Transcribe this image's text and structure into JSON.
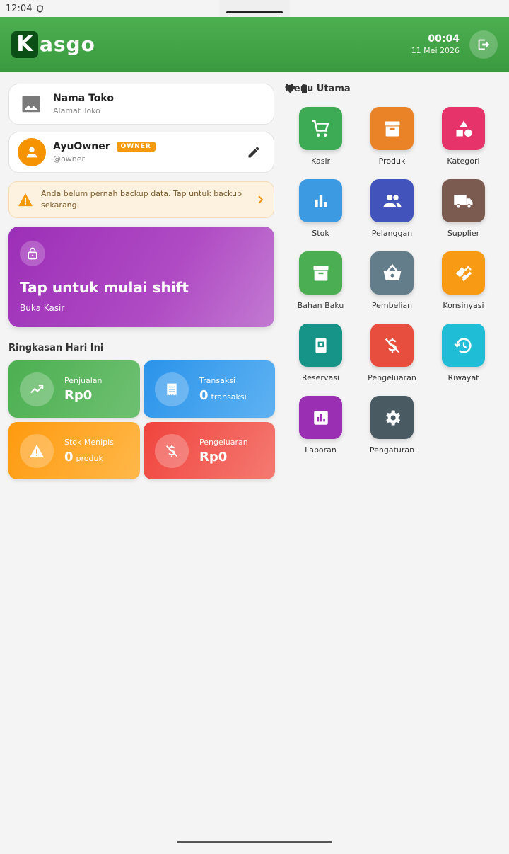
{
  "status": {
    "time": "12:04"
  },
  "header": {
    "logo_k": "K",
    "logo_rest": "asgo",
    "clock": "00:04",
    "date": "11 Mei 2026"
  },
  "store": {
    "name": "Nama Toko",
    "address": "Alamat Toko"
  },
  "user": {
    "name": "AyuOwner",
    "role": "OWNER",
    "handle": "@owner"
  },
  "warning": {
    "text": "Anda belum pernah backup data. Tap untuk backup sekarang."
  },
  "shift": {
    "title": "Tap untuk mulai shift",
    "subtitle": "Buka Kasir"
  },
  "summary": {
    "title": "Ringkasan Hari Ini",
    "cards": [
      {
        "label": "Penjualan",
        "value": "Rp0",
        "unit": ""
      },
      {
        "label": "Transaksi",
        "value": "0",
        "unit": "transaksi"
      },
      {
        "label": "Stok Menipis",
        "value": "0",
        "unit": "produk"
      },
      {
        "label": "Pengeluaran",
        "value": "Rp0",
        "unit": ""
      }
    ]
  },
  "menu": {
    "title": "Menu Utama",
    "items": [
      {
        "label": "Kasir",
        "icon": "cart-icon",
        "color": "#3daa56"
      },
      {
        "label": "Produk",
        "icon": "archive-icon",
        "color": "#ea8228"
      },
      {
        "label": "Kategori",
        "icon": "category-icon",
        "color": "#e6336a"
      },
      {
        "label": "Stok",
        "icon": "bar-chart-icon",
        "color": "#3c9ae2"
      },
      {
        "label": "Pelanggan",
        "icon": "people-icon",
        "color": "#4254bc"
      },
      {
        "label": "Supplier",
        "icon": "truck-icon",
        "color": "#7b5a50"
      },
      {
        "label": "Bahan Baku",
        "icon": "box-icon",
        "color": "#4cae52"
      },
      {
        "label": "Pembelian",
        "icon": "basket-icon",
        "color": "#647d8b"
      },
      {
        "label": "Konsinyasi",
        "icon": "handshake-icon",
        "color": "#f99a14"
      },
      {
        "label": "Reservasi",
        "icon": "book-icon",
        "color": "#159487"
      },
      {
        "label": "Pengeluaran",
        "icon": "money-off-icon",
        "color": "#e84e3e"
      },
      {
        "label": "Riwayat",
        "icon": "history-icon",
        "color": "#1fbdd6"
      },
      {
        "label": "Laporan",
        "icon": "report-icon",
        "color": "#9a2fb4"
      },
      {
        "label": "Pengaturan",
        "icon": "gear-icon",
        "color": "#4a5a63"
      }
    ]
  }
}
